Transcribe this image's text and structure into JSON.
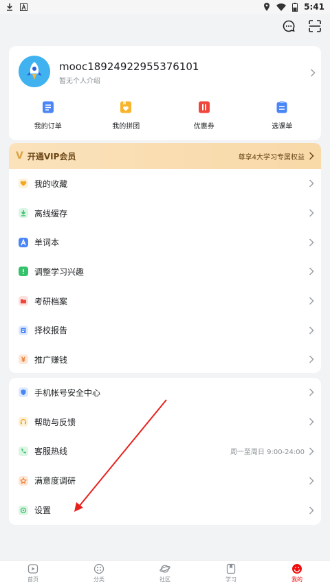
{
  "status_bar": {
    "time": "5:41",
    "left_icons": [
      "download-icon",
      "app-a-icon"
    ],
    "right_icons": [
      "location-icon",
      "wifi-icon",
      "battery-icon"
    ]
  },
  "top_bar": {
    "icons": [
      "message-icon",
      "scan-icon"
    ]
  },
  "profile": {
    "username": "mooc18924922955376101",
    "intro": "暂无个人介绍",
    "avatar_icon": "rocket-icon"
  },
  "quick_actions": [
    {
      "label": "我的订单",
      "icon": "order-icon",
      "color": "#4a86f7"
    },
    {
      "label": "我的拼团",
      "icon": "group-buy-icon",
      "color": "#f7b42c"
    },
    {
      "label": "优惠券",
      "icon": "coupon-icon",
      "color": "#f0453a"
    },
    {
      "label": "选课单",
      "icon": "course-list-icon",
      "color": "#4a86f7"
    }
  ],
  "vip": {
    "badge": "V",
    "title": "开通VIP会员",
    "benefit": "尊享4大学习专属权益"
  },
  "menu": [
    {
      "label": "我的收藏",
      "icon": "heart-icon",
      "color": "#f5a623"
    },
    {
      "label": "离线缓存",
      "icon": "download-icon",
      "color": "#35c26a"
    },
    {
      "label": "单词本",
      "icon": "word-book-icon",
      "color": "#4a86f7"
    },
    {
      "label": "调整学习兴趣",
      "icon": "interest-icon",
      "color": "#35c26a"
    },
    {
      "label": "考研档案",
      "icon": "folder-icon",
      "color": "#f0453a"
    },
    {
      "label": "择校报告",
      "icon": "report-icon",
      "color": "#4a86f7"
    },
    {
      "label": "推广赚钱",
      "icon": "money-icon",
      "color": "#f07a2c"
    }
  ],
  "settings_menu": [
    {
      "label": "手机帐号安全中心",
      "icon": "shield-icon",
      "color": "#4a86f7",
      "extra": ""
    },
    {
      "label": "帮助与反馈",
      "icon": "headphone-icon",
      "color": "#f5a623",
      "extra": ""
    },
    {
      "label": "客服热线",
      "icon": "phone-icon",
      "color": "#35c26a",
      "extra": "周一至周日 9:00-24:00"
    },
    {
      "label": "满意度调研",
      "icon": "star-icon",
      "color": "#f07a2c",
      "extra": ""
    },
    {
      "label": "设置",
      "icon": "settings-icon",
      "color": "#35c26a",
      "extra": ""
    }
  ],
  "tabs": [
    {
      "label": "首页",
      "icon": "home-play-icon",
      "active": false
    },
    {
      "label": "分类",
      "icon": "category-icon",
      "active": false
    },
    {
      "label": "社区",
      "icon": "planet-icon",
      "active": false
    },
    {
      "label": "学习",
      "icon": "study-icon",
      "active": false
    },
    {
      "label": "我的",
      "icon": "profile-icon",
      "active": true
    }
  ],
  "colors": {
    "accent": "#f20d0d",
    "arrow_annotation": "#e8201c",
    "vip_text": "#6a4616"
  }
}
